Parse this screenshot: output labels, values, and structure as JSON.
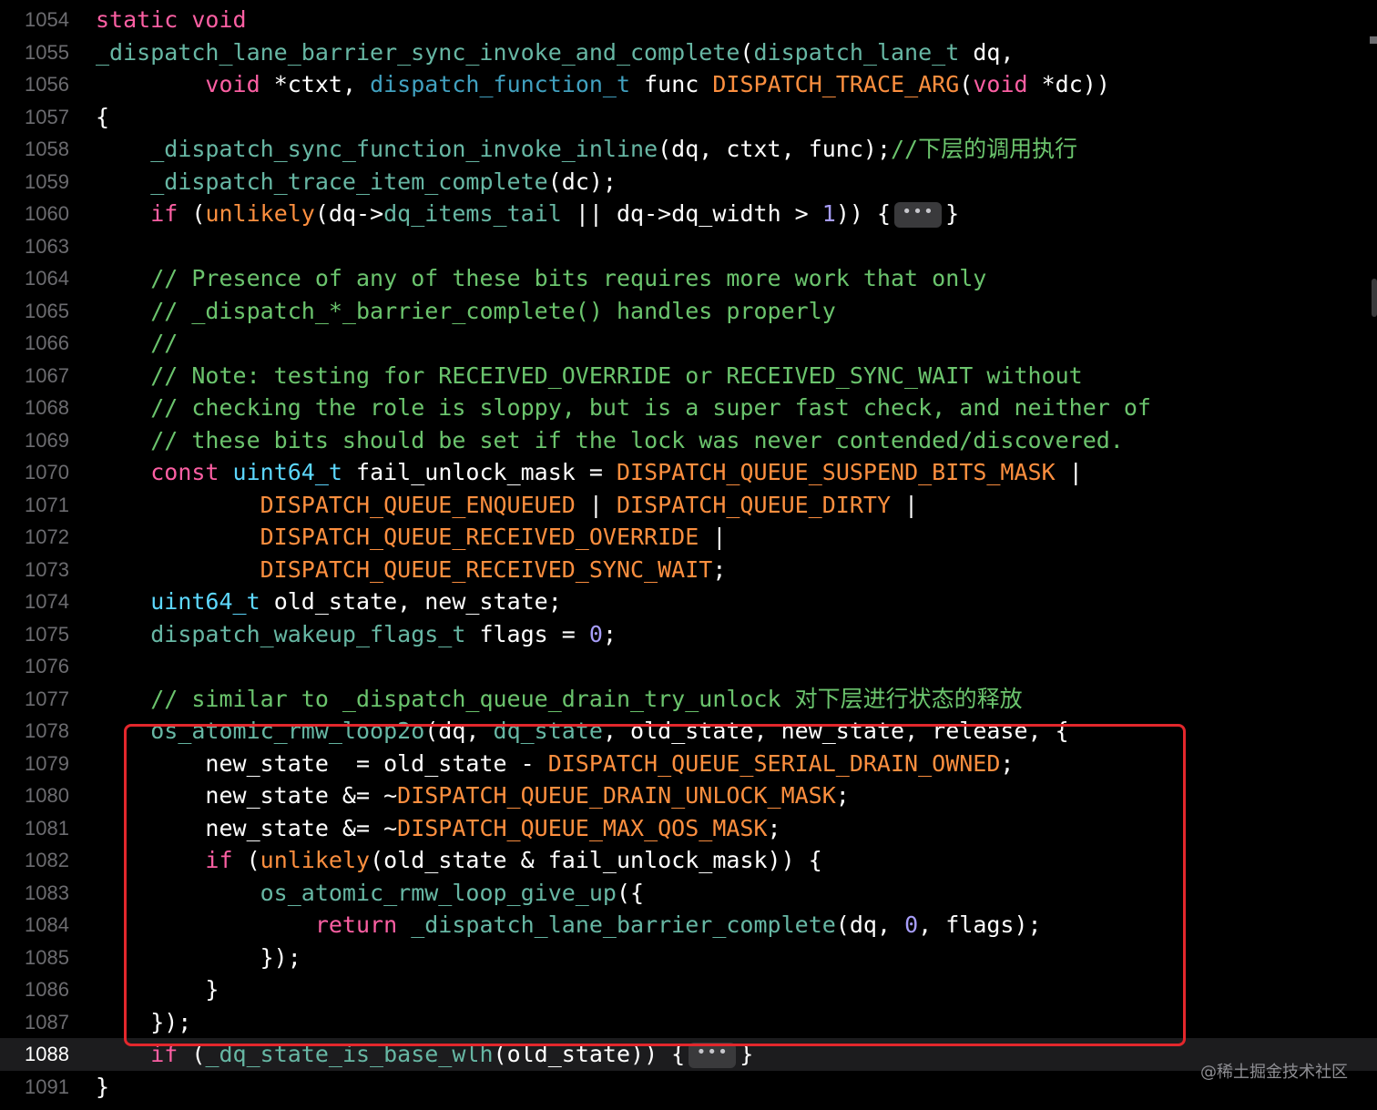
{
  "editor": {
    "accent_colors": {
      "keyword": "#fc5fa3",
      "type": "#5dd8ff",
      "function": "#67b7a4",
      "macro": "#fd8f3f",
      "comment": "#6bc46d",
      "number": "#a79df8",
      "highlight_box": "#e3272c"
    },
    "lines": [
      {
        "n": "1054",
        "t": [
          [
            "kw",
            "static void"
          ]
        ]
      },
      {
        "n": "1055",
        "t": [
          [
            "fn",
            "_dispatch_lane_barrier_sync_invoke_and_complete"
          ],
          [
            "",
            "("
          ],
          [
            "fn",
            "dispatch_lane_t"
          ],
          [
            "",
            " dq,"
          ]
        ]
      },
      {
        "n": "1056",
        "t": [
          [
            "",
            "        "
          ],
          [
            "kw",
            "void"
          ],
          [
            "",
            " *ctxt, "
          ],
          [
            "fg",
            "dispatch_function_t"
          ],
          [
            "",
            " func "
          ],
          [
            "mc",
            "DISPATCH_TRACE_ARG"
          ],
          [
            "",
            "("
          ],
          [
            "kw",
            "void"
          ],
          [
            "",
            " *dc))"
          ]
        ]
      },
      {
        "n": "1057",
        "t": [
          [
            "",
            "{"
          ]
        ]
      },
      {
        "n": "1058",
        "t": [
          [
            "",
            "    "
          ],
          [
            "fn",
            "_dispatch_sync_function_invoke_inline"
          ],
          [
            "",
            "(dq, ctxt, func);"
          ],
          [
            "cm",
            "//下层的调用执行"
          ]
        ]
      },
      {
        "n": "1059",
        "t": [
          [
            "",
            "    "
          ],
          [
            "fn",
            "_dispatch_trace_item_complete"
          ],
          [
            "",
            "(dc);"
          ]
        ]
      },
      {
        "n": "1060",
        "t": [
          [
            "",
            "    "
          ],
          [
            "kw",
            "if"
          ],
          [
            "",
            " ("
          ],
          [
            "mc",
            "unlikely"
          ],
          [
            "",
            "(dq->"
          ],
          [
            "fn",
            "dq_items_tail"
          ],
          [
            "",
            " || dq->dq_width > "
          ],
          [
            "nm",
            "1"
          ],
          [
            "",
            ")) {"
          ],
          [
            "fold",
            "•••"
          ],
          [
            "",
            "}"
          ]
        ]
      },
      {
        "n": "1063",
        "t": []
      },
      {
        "n": "1064",
        "t": [
          [
            "",
            "    "
          ],
          [
            "cm",
            "// Presence of any of these bits requires more work that only"
          ]
        ]
      },
      {
        "n": "1065",
        "t": [
          [
            "",
            "    "
          ],
          [
            "cm",
            "// _dispatch_*_barrier_complete() handles properly"
          ]
        ]
      },
      {
        "n": "1066",
        "t": [
          [
            "",
            "    "
          ],
          [
            "cm",
            "//"
          ]
        ]
      },
      {
        "n": "1067",
        "t": [
          [
            "",
            "    "
          ],
          [
            "cm",
            "// Note: testing for RECEIVED_OVERRIDE or RECEIVED_SYNC_WAIT without"
          ]
        ]
      },
      {
        "n": "1068",
        "t": [
          [
            "",
            "    "
          ],
          [
            "cm",
            "// checking the role is sloppy, but is a super fast check, and neither of"
          ]
        ]
      },
      {
        "n": "1069",
        "t": [
          [
            "",
            "    "
          ],
          [
            "cm",
            "// these bits should be set if the lock was never contended/discovered."
          ]
        ]
      },
      {
        "n": "1070",
        "t": [
          [
            "",
            "    "
          ],
          [
            "kw",
            "const"
          ],
          [
            "",
            " "
          ],
          [
            "ty",
            "uint64_t"
          ],
          [
            "",
            " fail_unlock_mask = "
          ],
          [
            "mc",
            "DISPATCH_QUEUE_SUSPEND_BITS_MASK"
          ],
          [
            "",
            " |"
          ]
        ]
      },
      {
        "n": "1071",
        "t": [
          [
            "",
            "            "
          ],
          [
            "mc",
            "DISPATCH_QUEUE_ENQUEUED"
          ],
          [
            "",
            " | "
          ],
          [
            "mc",
            "DISPATCH_QUEUE_DIRTY"
          ],
          [
            "",
            " |"
          ]
        ]
      },
      {
        "n": "1072",
        "t": [
          [
            "",
            "            "
          ],
          [
            "mc",
            "DISPATCH_QUEUE_RECEIVED_OVERRIDE"
          ],
          [
            "",
            " |"
          ]
        ]
      },
      {
        "n": "1073",
        "t": [
          [
            "",
            "            "
          ],
          [
            "mc",
            "DISPATCH_QUEUE_RECEIVED_SYNC_WAIT"
          ],
          [
            "",
            ";"
          ]
        ]
      },
      {
        "n": "1074",
        "t": [
          [
            "",
            "    "
          ],
          [
            "ty",
            "uint64_t"
          ],
          [
            "",
            " old_state, new_state;"
          ]
        ]
      },
      {
        "n": "1075",
        "t": [
          [
            "",
            "    "
          ],
          [
            "fn",
            "dispatch_wakeup_flags_t"
          ],
          [
            "",
            " flags = "
          ],
          [
            "nm",
            "0"
          ],
          [
            "",
            ";"
          ]
        ]
      },
      {
        "n": "1076",
        "t": []
      },
      {
        "n": "1077",
        "t": [
          [
            "",
            "    "
          ],
          [
            "cm",
            "// similar to _dispatch_queue_drain_try_unlock 对下层进行状态的释放"
          ]
        ]
      },
      {
        "n": "1078",
        "t": [
          [
            "",
            "    "
          ],
          [
            "fn",
            "os_atomic_rmw_loop2o"
          ],
          [
            "",
            "(dq, "
          ],
          [
            "fn",
            "dq_state"
          ],
          [
            "",
            ", old_state, new_state, release, {"
          ]
        ]
      },
      {
        "n": "1079",
        "t": [
          [
            "",
            "        new_state  = old_state - "
          ],
          [
            "mc",
            "DISPATCH_QUEUE_SERIAL_DRAIN_OWNED"
          ],
          [
            "",
            ";"
          ]
        ]
      },
      {
        "n": "1080",
        "t": [
          [
            "",
            "        new_state &= ~"
          ],
          [
            "mc",
            "DISPATCH_QUEUE_DRAIN_UNLOCK_MASK"
          ],
          [
            "",
            ";"
          ]
        ]
      },
      {
        "n": "1081",
        "t": [
          [
            "",
            "        new_state &= ~"
          ],
          [
            "mc",
            "DISPATCH_QUEUE_MAX_QOS_MASK"
          ],
          [
            "",
            ";"
          ]
        ]
      },
      {
        "n": "1082",
        "t": [
          [
            "",
            "        "
          ],
          [
            "kw",
            "if"
          ],
          [
            "",
            " ("
          ],
          [
            "mc",
            "unlikely"
          ],
          [
            "",
            "(old_state & fail_unlock_mask)) {"
          ]
        ]
      },
      {
        "n": "1083",
        "t": [
          [
            "",
            "            "
          ],
          [
            "fn",
            "os_atomic_rmw_loop_give_up"
          ],
          [
            "",
            "({"
          ]
        ]
      },
      {
        "n": "1084",
        "t": [
          [
            "",
            "                "
          ],
          [
            "kw",
            "return"
          ],
          [
            "",
            " "
          ],
          [
            "fn",
            "_dispatch_lane_barrier_complete"
          ],
          [
            "",
            "(dq, "
          ],
          [
            "nm",
            "0"
          ],
          [
            "",
            ", flags);"
          ]
        ]
      },
      {
        "n": "1085",
        "t": [
          [
            "",
            "            });"
          ]
        ]
      },
      {
        "n": "1086",
        "t": [
          [
            "",
            "        }"
          ]
        ]
      },
      {
        "n": "1087",
        "t": [
          [
            "",
            "    });"
          ]
        ]
      },
      {
        "n": "1088",
        "t": [
          [
            "",
            "    "
          ],
          [
            "kw",
            "if"
          ],
          [
            "",
            " ("
          ],
          [
            "fn",
            "_dq_state_is_base_wlh"
          ],
          [
            "",
            "(old_state)) {"
          ],
          [
            "fold",
            "•••"
          ],
          [
            "",
            "}"
          ]
        ],
        "current": true
      },
      {
        "n": "1091",
        "t": [
          [
            "",
            "}"
          ]
        ]
      }
    ]
  },
  "watermark": "@稀土掘金技术社区"
}
